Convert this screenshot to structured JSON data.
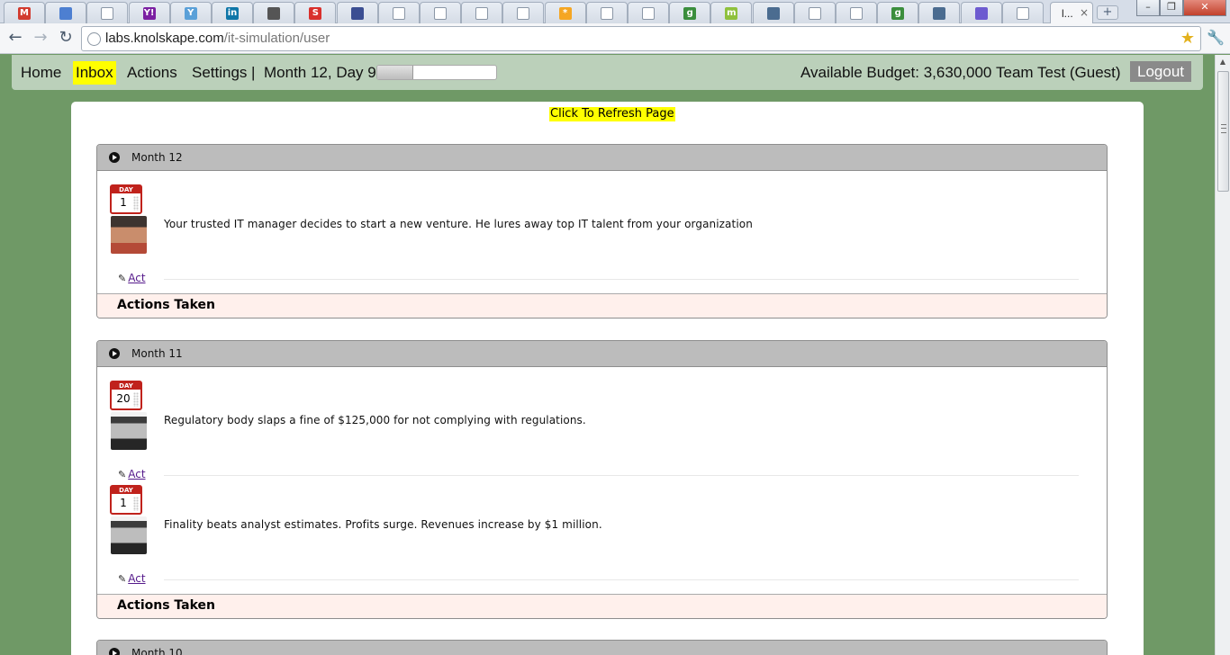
{
  "browser": {
    "tabs": [
      {
        "icon": "gmail-icon",
        "glyph": "M",
        "color": "#d23b2f"
      },
      {
        "icon": "doc-icon",
        "glyph": "",
        "color": "#4d7fd1"
      },
      {
        "icon": "page-icon",
        "glyph": "",
        "color": "#ffffff"
      },
      {
        "icon": "yahoo-icon",
        "glyph": "Y!",
        "color": "#7b1fa2"
      },
      {
        "icon": "yahoo-answers-icon",
        "glyph": "Y",
        "color": "#5aa0d8"
      },
      {
        "icon": "linkedin-icon",
        "glyph": "in",
        "color": "#0e76a8"
      },
      {
        "icon": "graduation-cap-icon",
        "glyph": "",
        "color": "#555555"
      },
      {
        "icon": "slideshare-icon",
        "glyph": "S",
        "color": "#d9302c"
      },
      {
        "icon": "grid-icon",
        "glyph": "",
        "color": "#3b4e92"
      },
      {
        "icon": "page-icon",
        "glyph": "",
        "color": "#ffffff"
      },
      {
        "icon": "page-icon",
        "glyph": "",
        "color": "#ffffff"
      },
      {
        "icon": "page-icon",
        "glyph": "",
        "color": "#ffffff"
      },
      {
        "icon": "page-icon",
        "glyph": "",
        "color": "#ffffff"
      },
      {
        "icon": "star-burst-icon",
        "glyph": "*",
        "color": "#f5a623"
      },
      {
        "icon": "page-icon",
        "glyph": "",
        "color": "#ffffff"
      },
      {
        "icon": "page-icon",
        "glyph": "",
        "color": "#ffffff"
      },
      {
        "icon": "google-icon",
        "glyph": "g",
        "color": "#3b8e3d"
      },
      {
        "icon": "m-icon",
        "glyph": "m",
        "color": "#8fc13d"
      },
      {
        "icon": "photo-icon",
        "glyph": "",
        "color": "#4b6c90"
      },
      {
        "icon": "page-icon",
        "glyph": "",
        "color": "#ffffff"
      },
      {
        "icon": "page-icon",
        "glyph": "",
        "color": "#ffffff"
      },
      {
        "icon": "google-icon",
        "glyph": "g",
        "color": "#3b8e3d"
      },
      {
        "icon": "photo-icon",
        "glyph": "",
        "color": "#4b6c90"
      },
      {
        "icon": "calendar-icon",
        "glyph": "",
        "color": "#6d5bd0"
      },
      {
        "icon": "page-icon",
        "glyph": "",
        "color": "#ffffff"
      }
    ],
    "active_tab_title": "l...",
    "active_tab_close": "×",
    "new_tab": "+",
    "url_host": "labs.knolskape.com",
    "url_path": "/it-simulation/user"
  },
  "nav": {
    "home": "Home",
    "inbox": "Inbox",
    "actions": "Actions",
    "settings": "Settings",
    "separator": "|",
    "date": "Month 12, Day 9",
    "progress_fraction": 0.3,
    "budget": "Available Budget: 3,630,000",
    "team": "Team Test (Guest)",
    "logout": "Logout"
  },
  "refresh_label": "Click To Refresh Page",
  "months": [
    {
      "title": "Month 12",
      "events": [
        {
          "day_label": "DAY",
          "day": "1",
          "text": "Your trusted IT manager decides to start a new venture. He lures away top IT talent from your organization",
          "act": "Act"
        }
      ],
      "actions_taken": "Actions Taken"
    },
    {
      "title": "Month 11",
      "events": [
        {
          "day_label": "DAY",
          "day": "20",
          "text": "Regulatory body slaps a fine of $125,000 for not complying with regulations.",
          "act": "Act"
        },
        {
          "day_label": "DAY",
          "day": "1",
          "text": "Finality beats analyst estimates. Profits surge. Revenues increase by $1 million.",
          "act": "Act"
        }
      ],
      "actions_taken": "Actions Taken"
    },
    {
      "title": "Month 10"
    }
  ]
}
